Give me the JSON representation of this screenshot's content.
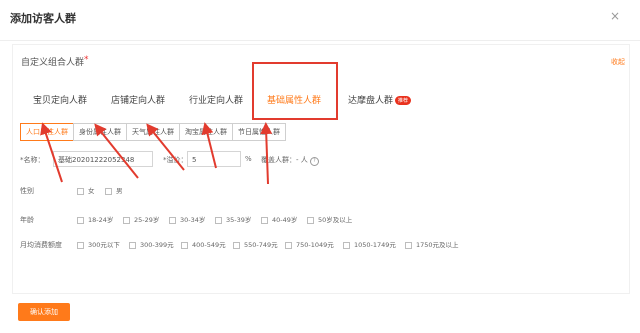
{
  "modal": {
    "title": "添加访客人群",
    "close_icon": "×"
  },
  "combo": {
    "title": "自定义组合人群",
    "required_mark": "*",
    "collapse_label": "收起"
  },
  "tabs": [
    {
      "label": "宝贝定向人群"
    },
    {
      "label": "店铺定向人群"
    },
    {
      "label": "行业定向人群"
    },
    {
      "label": "基础属性人群"
    },
    {
      "label": "达摩盘人群",
      "badge": "推荐"
    }
  ],
  "subtabs": [
    {
      "label": "人口属性人群"
    },
    {
      "label": "身份属性人群"
    },
    {
      "label": "天气属性人群"
    },
    {
      "label": "淘宝属性人群"
    },
    {
      "label": "节日属性人群"
    }
  ],
  "form": {
    "name_label": "*名称：",
    "name_value": "基础20201222052348",
    "premium_label": "*溢价：",
    "premium_value": "5",
    "premium_suffix": "%",
    "coverage_label": "覆盖人群：",
    "coverage_value": "- 人",
    "help_icon": "?"
  },
  "gender": {
    "label": "性别",
    "options": [
      "女",
      "男"
    ]
  },
  "age": {
    "label": "年龄",
    "options": [
      "18-24岁",
      "25-29岁",
      "30-34岁",
      "35-39岁",
      "40-49岁",
      "50岁及以上"
    ]
  },
  "spend": {
    "label": "月均消费额度",
    "options": [
      "300元以下",
      "300-399元",
      "400-549元",
      "550-749元",
      "750-1049元",
      "1050-1749元",
      "1750元及以上"
    ]
  },
  "footer": {
    "confirm_label": "确认添加"
  },
  "colors": {
    "accent": "#ff7a1a",
    "annotation": "#e23b2e"
  }
}
